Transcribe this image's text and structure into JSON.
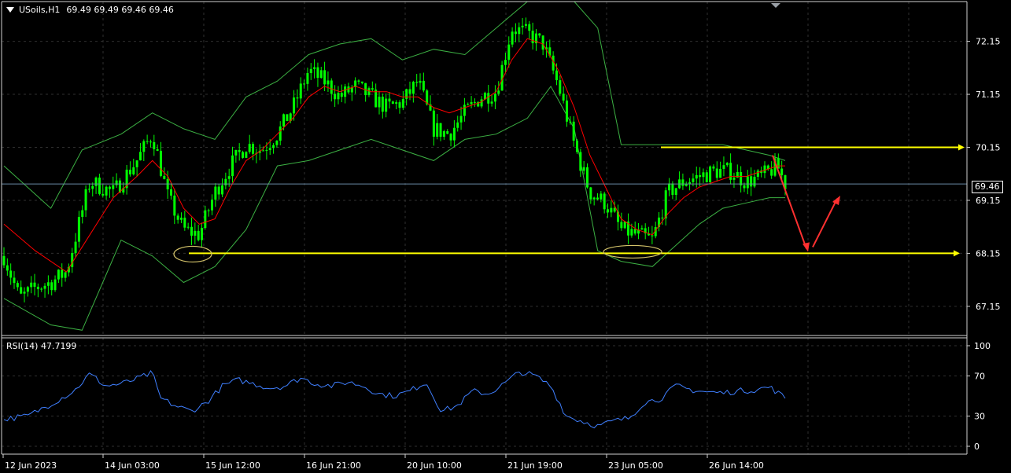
{
  "header": {
    "symbol_label": "USoils,H1",
    "ohlc_text": "69.49 69.49 69.46 69.46"
  },
  "rsi_panel": {
    "label": "RSI(14) 47.7199"
  },
  "price_tag": "69.46",
  "colors": {
    "background": "#000000",
    "grid": "#2f2f2f",
    "candles": "#00ff00",
    "bollinger": "#3cb043",
    "moving_average": "#ff0000",
    "rsi_line": "#3f7fff",
    "levels": "#ffff00",
    "projection_arrows": "#ff3030",
    "markers": "#d4c36a"
  },
  "chart_data": [
    {
      "type": "candlestick",
      "title": "USoils,H1",
      "ylim": [
        66.6,
        72.9
      ],
      "y_ticks": [
        "72.15",
        "71.15",
        "70.15",
        "69.15",
        "68.15",
        "67.15"
      ],
      "x_ticks": [
        "12 Jun 2023",
        "14 Jun 03:00",
        "15 Jun 12:00",
        "16 Jun 21:00",
        "20 Jun 10:00",
        "21 Jun 19:00",
        "23 Jun 05:00",
        "26 Jun 14:00"
      ],
      "last_price": 69.46,
      "series": [
        {
          "name": "close_path",
          "points": [
            [
              0,
              68.1
            ],
            [
              2,
              67.3
            ],
            [
              4,
              67.5
            ],
            [
              6,
              67.6
            ],
            [
              8,
              67.8
            ],
            [
              11,
              69.5
            ],
            [
              14,
              69.3
            ],
            [
              17,
              69.9
            ],
            [
              19,
              70.4
            ],
            [
              21,
              69.2
            ],
            [
              23,
              68.6
            ],
            [
              25,
              68.5
            ],
            [
              27,
              69.3
            ],
            [
              29,
              69.8
            ],
            [
              31,
              70.2
            ],
            [
              33,
              70.1
            ],
            [
              35,
              70.4
            ],
            [
              37,
              70.9
            ],
            [
              39,
              71.6
            ],
            [
              41,
              71.4
            ],
            [
              43,
              71.1
            ],
            [
              45,
              71.3
            ],
            [
              47,
              71.1
            ],
            [
              49,
              70.9
            ],
            [
              51,
              71.0
            ],
            [
              53,
              71.4
            ],
            [
              55,
              70.5
            ],
            [
              57,
              70.4
            ],
            [
              59,
              70.8
            ],
            [
              61,
              71.1
            ],
            [
              63,
              71.2
            ],
            [
              65,
              72.4
            ],
            [
              67,
              72.3
            ],
            [
              69,
              72.1
            ],
            [
              71,
              71.3
            ],
            [
              73,
              70.2
            ],
            [
              75,
              69.3
            ],
            [
              77,
              69.1
            ],
            [
              79,
              68.6
            ],
            [
              81,
              68.5
            ],
            [
              83,
              68.4
            ],
            [
              85,
              69.3
            ],
            [
              87,
              69.5
            ],
            [
              89,
              69.6
            ],
            [
              91,
              69.7
            ],
            [
              93,
              69.7
            ],
            [
              95,
              69.5
            ],
            [
              97,
              69.6
            ],
            [
              99,
              69.8
            ],
            [
              100,
              69.46
            ]
          ]
        },
        {
          "name": "upper_band",
          "points": [
            [
              0,
              69.8
            ],
            [
              6,
              69.0
            ],
            [
              10,
              70.1
            ],
            [
              15,
              70.4
            ],
            [
              19,
              70.8
            ],
            [
              23,
              70.5
            ],
            [
              27,
              70.3
            ],
            [
              31,
              71.1
            ],
            [
              35,
              71.4
            ],
            [
              39,
              71.9
            ],
            [
              43,
              72.1
            ],
            [
              47,
              72.2
            ],
            [
              51,
              71.8
            ],
            [
              55,
              72.0
            ],
            [
              59,
              71.9
            ],
            [
              63,
              72.4
            ],
            [
              67,
              72.9
            ],
            [
              70,
              72.9
            ],
            [
              73,
              72.9
            ],
            [
              76,
              72.4
            ],
            [
              79,
              70.2
            ],
            [
              83,
              70.2
            ],
            [
              86,
              70.2
            ],
            [
              89,
              70.2
            ],
            [
              92,
              70.2
            ],
            [
              95,
              70.1
            ],
            [
              98,
              70.0
            ],
            [
              100,
              69.9
            ]
          ]
        },
        {
          "name": "lower_band",
          "points": [
            [
              0,
              67.3
            ],
            [
              6,
              66.8
            ],
            [
              10,
              66.7
            ],
            [
              15,
              68.4
            ],
            [
              19,
              68.1
            ],
            [
              23,
              67.6
            ],
            [
              27,
              67.9
            ],
            [
              31,
              68.6
            ],
            [
              35,
              69.8
            ],
            [
              39,
              69.9
            ],
            [
              43,
              70.1
            ],
            [
              47,
              70.3
            ],
            [
              51,
              70.1
            ],
            [
              55,
              69.9
            ],
            [
              59,
              70.3
            ],
            [
              63,
              70.4
            ],
            [
              67,
              70.7
            ],
            [
              70,
              71.3
            ],
            [
              73,
              70.5
            ],
            [
              76,
              68.2
            ],
            [
              79,
              68.0
            ],
            [
              83,
              67.9
            ],
            [
              86,
              68.3
            ],
            [
              89,
              68.7
            ],
            [
              92,
              69.0
            ],
            [
              95,
              69.1
            ],
            [
              98,
              69.2
            ],
            [
              100,
              69.2
            ]
          ]
        },
        {
          "name": "moving_average",
          "points": [
            [
              0,
              68.7
            ],
            [
              4,
              68.2
            ],
            [
              8,
              67.8
            ],
            [
              11,
              68.5
            ],
            [
              14,
              69.2
            ],
            [
              17,
              69.6
            ],
            [
              19,
              69.9
            ],
            [
              21,
              69.6
            ],
            [
              23,
              69.0
            ],
            [
              25,
              68.7
            ],
            [
              27,
              68.8
            ],
            [
              29,
              69.4
            ],
            [
              31,
              69.9
            ],
            [
              33,
              70.1
            ],
            [
              35,
              70.4
            ],
            [
              37,
              70.7
            ],
            [
              39,
              71.1
            ],
            [
              41,
              71.3
            ],
            [
              43,
              71.2
            ],
            [
              45,
              71.3
            ],
            [
              47,
              71.2
            ],
            [
              49,
              71.2
            ],
            [
              51,
              71.1
            ],
            [
              53,
              71.1
            ],
            [
              55,
              70.9
            ],
            [
              57,
              70.8
            ],
            [
              59,
              70.9
            ],
            [
              61,
              71.0
            ],
            [
              63,
              71.2
            ],
            [
              65,
              71.8
            ],
            [
              67,
              72.2
            ],
            [
              69,
              72.1
            ],
            [
              71,
              71.6
            ],
            [
              73,
              70.9
            ],
            [
              75,
              70.0
            ],
            [
              77,
              69.4
            ],
            [
              79,
              68.8
            ],
            [
              81,
              68.6
            ],
            [
              83,
              68.5
            ],
            [
              85,
              68.9
            ],
            [
              87,
              69.2
            ],
            [
              89,
              69.4
            ],
            [
              91,
              69.5
            ],
            [
              93,
              69.6
            ],
            [
              95,
              69.6
            ],
            [
              97,
              69.7
            ],
            [
              99,
              69.8
            ],
            [
              100,
              69.8
            ]
          ]
        }
      ],
      "annotations": [
        {
          "type": "horizontal-level",
          "value": 70.15,
          "color": "#ffff00"
        },
        {
          "type": "horizontal-level",
          "value": 68.15,
          "color": "#ffff00"
        },
        {
          "type": "horizontal-line",
          "value": 69.46,
          "color": "#6a8ca8"
        },
        {
          "type": "ellipse-marker",
          "value": 68.15
        },
        {
          "type": "ellipse-marker",
          "value": 68.15
        },
        {
          "type": "projection-arrow",
          "from": 70.0,
          "to": 68.15
        },
        {
          "type": "projection-arrow",
          "from": 68.15,
          "to": 69.15
        }
      ]
    },
    {
      "type": "line",
      "title": "RSI(14) 47.7199",
      "ylim": [
        0,
        100
      ],
      "y_ticks": [
        "100",
        "70",
        "30",
        "0"
      ],
      "series": [
        {
          "name": "RSI(14)",
          "points": [
            [
              0,
              27
            ],
            [
              3,
              30
            ],
            [
              6,
              42
            ],
            [
              9,
              55
            ],
            [
              11,
              72
            ],
            [
              13,
              60
            ],
            [
              15,
              62
            ],
            [
              17,
              67
            ],
            [
              19,
              73
            ],
            [
              20,
              48
            ],
            [
              22,
              40
            ],
            [
              24,
              35
            ],
            [
              26,
              44
            ],
            [
              28,
              60
            ],
            [
              30,
              66
            ],
            [
              32,
              62
            ],
            [
              34,
              58
            ],
            [
              36,
              60
            ],
            [
              38,
              68
            ],
            [
              40,
              62
            ],
            [
              42,
              60
            ],
            [
              44,
              64
            ],
            [
              46,
              60
            ],
            [
              48,
              52
            ],
            [
              50,
              50
            ],
            [
              52,
              55
            ],
            [
              54,
              64
            ],
            [
              56,
              35
            ],
            [
              58,
              40
            ],
            [
              60,
              55
            ],
            [
              62,
              52
            ],
            [
              64,
              62
            ],
            [
              66,
              74
            ],
            [
              68,
              70
            ],
            [
              70,
              60
            ],
            [
              72,
              30
            ],
            [
              74,
              25
            ],
            [
              76,
              20
            ],
            [
              78,
              25
            ],
            [
              80,
              28
            ],
            [
              82,
              44
            ],
            [
              84,
              47
            ],
            [
              86,
              60
            ],
            [
              88,
              56
            ],
            [
              90,
              54
            ],
            [
              92,
              53
            ],
            [
              94,
              55
            ],
            [
              96,
              56
            ],
            [
              98,
              59
            ],
            [
              100,
              48
            ]
          ]
        }
      ]
    }
  ]
}
